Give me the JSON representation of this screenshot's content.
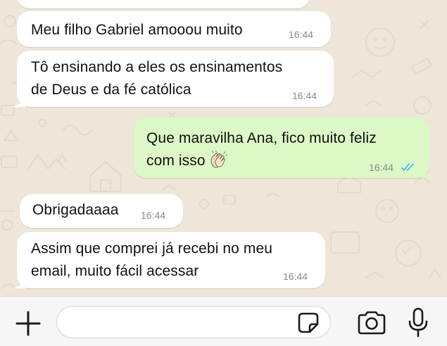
{
  "messages": [
    {
      "direction": "incoming",
      "lines": [
        "Meu filho Gabriel amooou muito"
      ],
      "time": "16:44"
    },
    {
      "direction": "incoming",
      "lines": [
        "Tô ensinando a eles os ensinamentos",
        "de Deus e da fé católica"
      ],
      "time": "16:44"
    },
    {
      "direction": "outgoing",
      "lines": [
        "Que maravilha Ana, fico muito feliz",
        "com isso"
      ],
      "emoji": "clapping-hands",
      "time": "16:44",
      "status": "read"
    },
    {
      "direction": "incoming",
      "lines": [
        "Obrigadaaaa"
      ],
      "time": "16:44"
    },
    {
      "direction": "incoming",
      "lines": [
        "Assim que comprei já recebi no meu",
        "email, muito fácil acessar"
      ],
      "time": "16:44"
    }
  ],
  "input_bar": {
    "message_placeholder": "",
    "icons": [
      "plus-icon",
      "sticker-icon",
      "camera-icon",
      "microphone-icon"
    ]
  },
  "colors": {
    "incoming_bubble": "#ffffff",
    "outgoing_bubble": "#dcf8c6",
    "read_ticks": "#34b7f1",
    "timestamp": "#8a8a8a",
    "wallpaper": "#efe6da"
  }
}
